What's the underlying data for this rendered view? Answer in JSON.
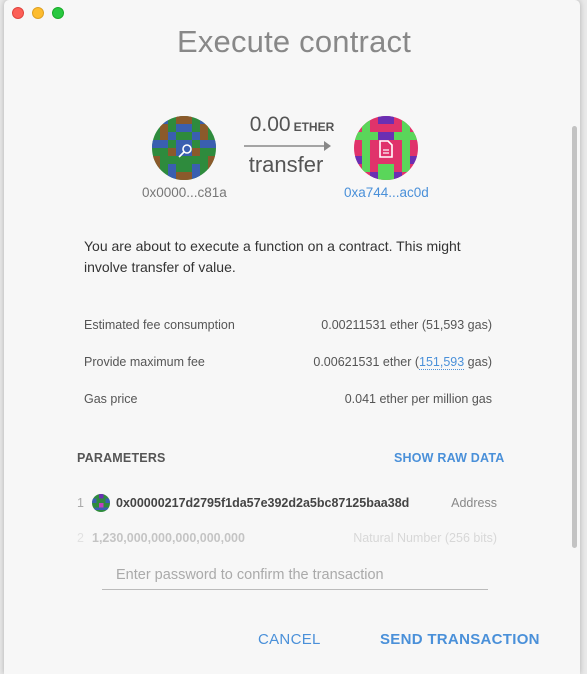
{
  "window": {
    "title": "Execute contract"
  },
  "transfer": {
    "amount": "0.00",
    "unit": "ETHER",
    "action": "transfer",
    "from_address": "0x0000...c81a",
    "to_address": "0xa744...ac0d"
  },
  "description": "You are about to execute a function on a contract. This might involve transfer of value.",
  "fees": {
    "estimated": {
      "label": "Estimated fee consumption",
      "value": "0.00211531 ether (51,593 gas)"
    },
    "maximum": {
      "label": "Provide maximum fee",
      "value_prefix": "0.00621531 ether (",
      "gas_link": "151,593",
      "value_suffix": " gas)"
    },
    "gas_price": {
      "label": "Gas price",
      "value": "0.041 ether per million gas"
    }
  },
  "parameters": {
    "heading": "PARAMETERS",
    "raw_link": "SHOW RAW DATA",
    "items": [
      {
        "index": "1",
        "value": "0x00000217d2795f1da57e392d2a5bc87125baa38d",
        "type": "Address"
      },
      {
        "index": "2",
        "value": "1,230,000,000,000,000,000",
        "type": "Natural Number (256 bits)"
      }
    ]
  },
  "password": {
    "placeholder": "Enter password to confirm the transaction"
  },
  "buttons": {
    "cancel": "CANCEL",
    "send": "SEND TRANSACTION"
  },
  "icons": {
    "from_badge": "key-icon",
    "to_badge": "document-icon"
  },
  "colors": {
    "accent": "#4a90d9"
  }
}
